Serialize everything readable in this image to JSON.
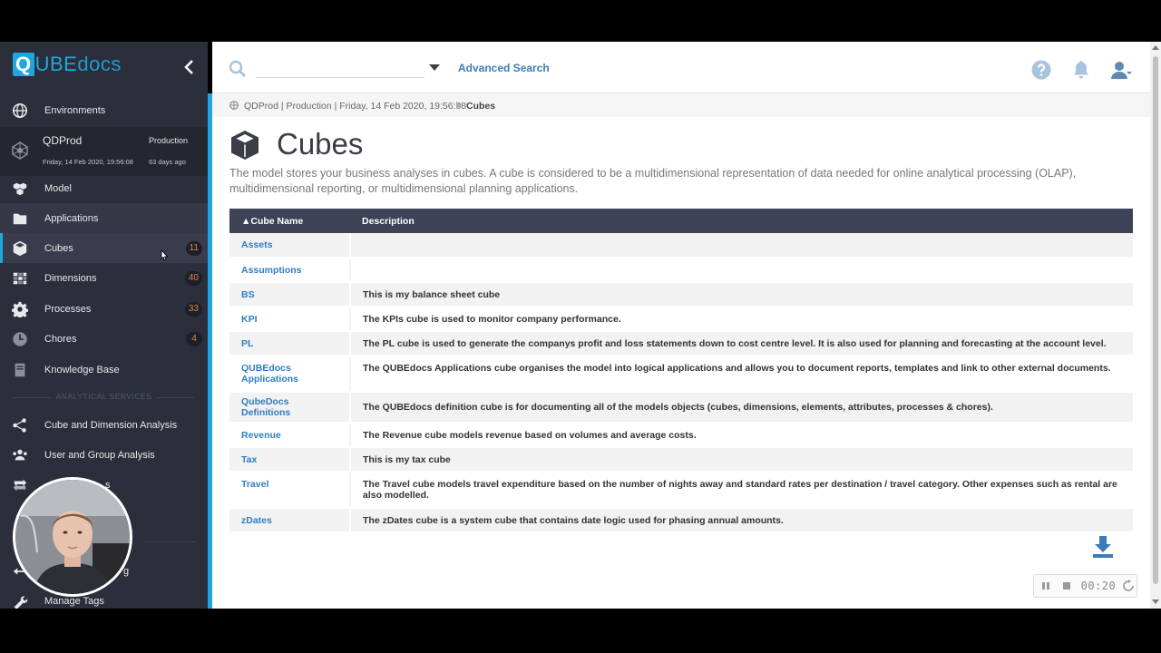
{
  "app": {
    "logo_q": "Q",
    "logo_ube": "UBE",
    "logo_docs": "docs"
  },
  "sidebar": {
    "environments_label": "Environments",
    "environment": {
      "name": "QDProd",
      "stage": "Production",
      "date": "Friday, 14 Feb 2020, 19:56:08",
      "age": "63 days ago"
    },
    "items": [
      {
        "label": "Model",
        "icon": "model-icon"
      },
      {
        "label": "Applications",
        "icon": "folder-icon"
      },
      {
        "label": "Cubes",
        "icon": "cube-icon",
        "count": "11"
      },
      {
        "label": "Dimensions",
        "icon": "dimensions-icon",
        "count": "40"
      },
      {
        "label": "Processes",
        "icon": "gear-icon",
        "count": "33"
      },
      {
        "label": "Chores",
        "icon": "clock-icon",
        "count": "4"
      },
      {
        "label": "Knowledge Base",
        "icon": "book-icon"
      }
    ],
    "section_label": "ANALYTICAL SERVICES",
    "analysis_items": [
      {
        "label": "Cube and Dimension Analysis",
        "icon": "network-icon"
      },
      {
        "label": "User and Group Analysis",
        "icon": "users-icon"
      }
    ],
    "partial_1": "s",
    "partial_2": "g",
    "manage_tags": "Manage Tags"
  },
  "topbar": {
    "search_placeholder": "",
    "advanced_search": "Advanced Search"
  },
  "breadcrumb": {
    "path": "QDProd | Production | Friday, 14 Feb 2020, 19:56:08",
    "current": "Cubes"
  },
  "page": {
    "title": "Cubes",
    "description": "The model stores your business analyses in cubes. A cube is considered to be a multidimensional representation of data needed for online analytical processing (OLAP), multidimensional reporting, or multidimensional planning applications."
  },
  "table": {
    "headers": {
      "name": "▲Cube Name",
      "description": "Description"
    },
    "rows": [
      {
        "name": "Assets",
        "description": ""
      },
      {
        "name": "Assumptions",
        "description": ""
      },
      {
        "name": "BS",
        "description": "This is my balance sheet cube"
      },
      {
        "name": "KPI",
        "description": "The KPIs cube is used to monitor company performance."
      },
      {
        "name": "PL",
        "description": "The PL cube is used to generate the companys profit and loss statements down to cost centre level. It is also used for planning and forecasting at the account level."
      },
      {
        "name": "QUBEdocs Applications",
        "description": "The QUBEdocs Applications cube organises the model into logical applications and allows you to document reports, templates and link to other external documents."
      },
      {
        "name": "QubeDocs Definitions",
        "description": "The QUBEdocs definition cube is for documenting all of the models objects (cubes, dimensions, elements, attributes, processes & chores)."
      },
      {
        "name": "Revenue",
        "description": "The Revenue cube models revenue based on volumes and average costs."
      },
      {
        "name": "Tax",
        "description": "This is my tax cube"
      },
      {
        "name": "Travel",
        "description": "The Travel cube models travel expenditure based on the number of nights away and standard rates per destination / travel category. Other expenses such as rental are also modelled."
      },
      {
        "name": "zDates",
        "description": "The zDates cube is a system cube that contains date logic used for phasing annual amounts."
      }
    ]
  },
  "recorder": {
    "time": "00:20"
  },
  "colors": {
    "sidebar_bg": "#2b2e3b",
    "accent": "#1fa8e0",
    "table_header": "#3e4256",
    "link": "#2f7dc0",
    "badge_text": "#e6863b"
  }
}
